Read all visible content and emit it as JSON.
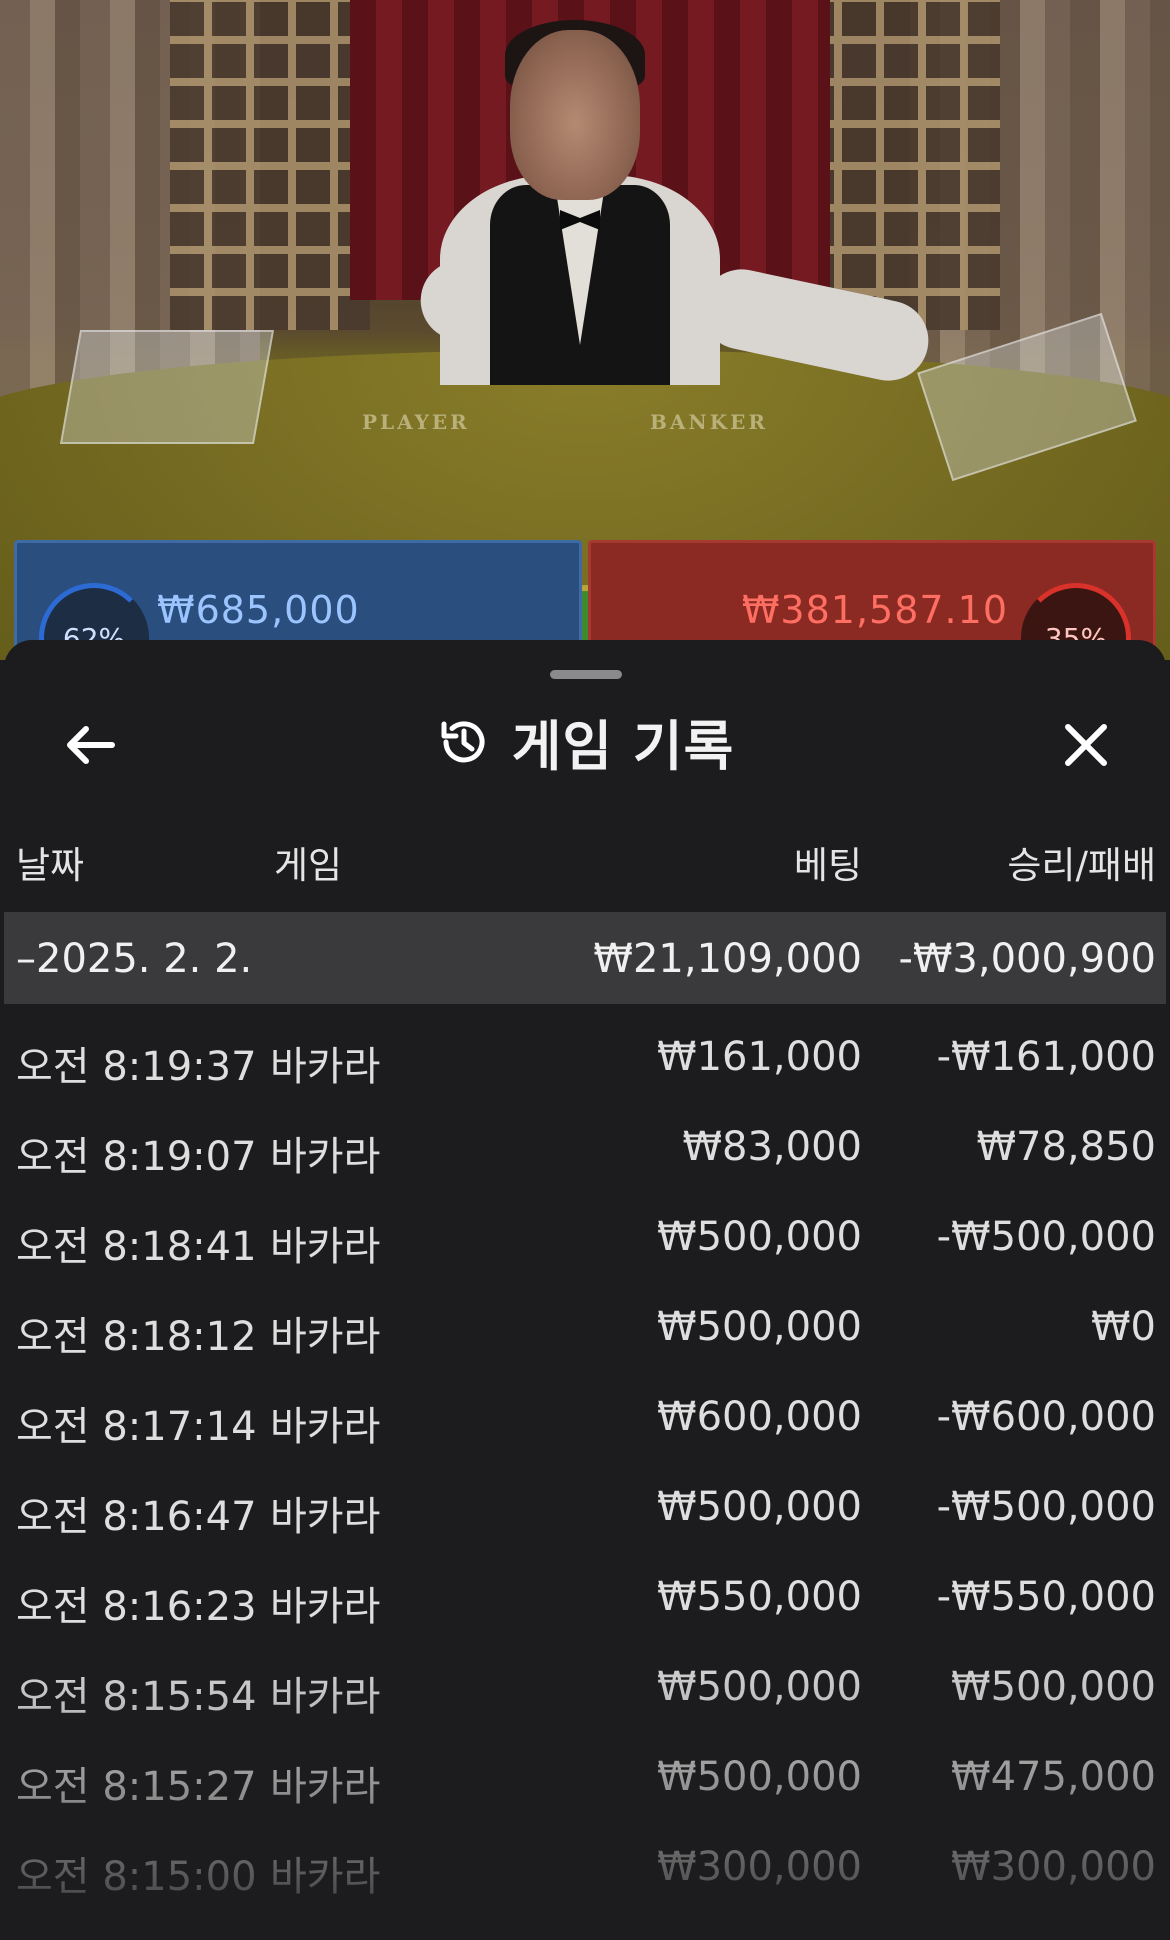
{
  "scene": {
    "table_labels": [
      "PLAYER",
      "BANKER"
    ]
  },
  "bets": {
    "player": {
      "percent": "62%",
      "amount": "₩685,000",
      "color": "#2d6bd4"
    },
    "banker": {
      "percent": "35%",
      "amount": "₩381,587.10",
      "color": "#d9322a"
    }
  },
  "sheet": {
    "title": "게임 기록",
    "icons": {
      "back": "arrow-left-icon",
      "history": "history-icon",
      "close": "close-icon"
    },
    "columns": {
      "date": "날짜",
      "game": "게임",
      "bet": "베팅",
      "win_loss": "승리/패배"
    },
    "group": {
      "date": "–2025. 2. 2.",
      "bet": "₩21,109,000",
      "win_loss": "-₩3,000,900"
    },
    "rows": [
      {
        "time": "오전 8:19:37",
        "game": "바카라",
        "bet": "₩161,000",
        "win_loss": "-₩161,000"
      },
      {
        "time": "오전 8:19:07",
        "game": "바카라",
        "bet": "₩83,000",
        "win_loss": "₩78,850"
      },
      {
        "time": "오전 8:18:41",
        "game": "바카라",
        "bet": "₩500,000",
        "win_loss": "-₩500,000"
      },
      {
        "time": "오전 8:18:12",
        "game": "바카라",
        "bet": "₩500,000",
        "win_loss": "₩0"
      },
      {
        "time": "오전 8:17:14",
        "game": "바카라",
        "bet": "₩600,000",
        "win_loss": "-₩600,000"
      },
      {
        "time": "오전 8:16:47",
        "game": "바카라",
        "bet": "₩500,000",
        "win_loss": "-₩500,000"
      },
      {
        "time": "오전 8:16:23",
        "game": "바카라",
        "bet": "₩550,000",
        "win_loss": "-₩550,000"
      },
      {
        "time": "오전 8:15:54",
        "game": "바카라",
        "bet": "₩500,000",
        "win_loss": "₩500,000"
      },
      {
        "time": "오전 8:15:27",
        "game": "바카라",
        "bet": "₩500,000",
        "win_loss": "₩475,000"
      },
      {
        "time": "오전 8:15:00",
        "game": "바카라",
        "bet": "₩300,000",
        "win_loss": "₩300,000"
      }
    ]
  }
}
